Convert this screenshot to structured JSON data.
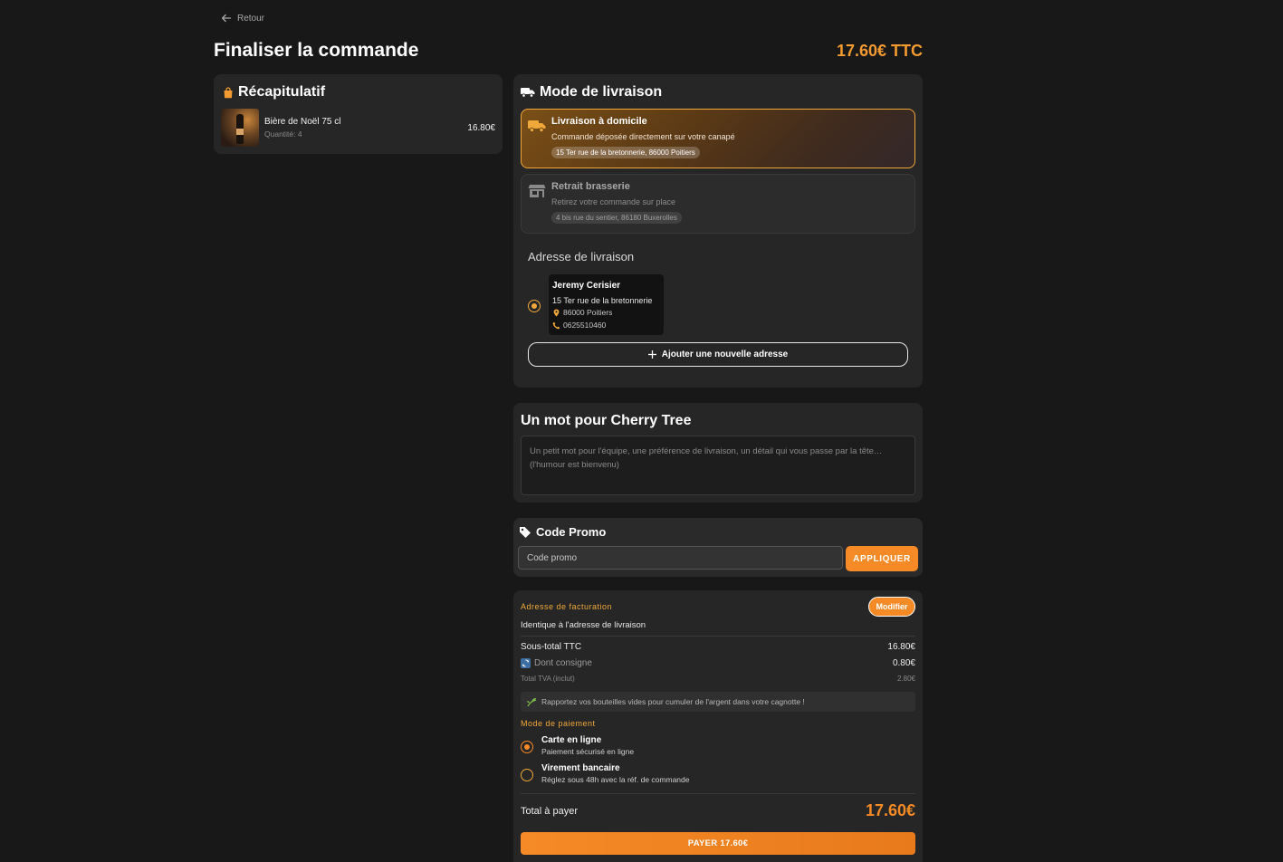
{
  "nav": {
    "back_label": "Retour"
  },
  "header": {
    "title": "Finaliser la commande",
    "total": "17.60€ TTC"
  },
  "summary": {
    "title": "Récapitulatif",
    "items": [
      {
        "name": "Bière de Noël 75 cl",
        "quantity": "Quantité: 4",
        "price": "16.80€"
      }
    ]
  },
  "delivery": {
    "title": "Mode de livraison",
    "options": [
      {
        "title": "Livraison à domicile",
        "description": "Commande déposée directement sur votre canapé",
        "address": "15 Ter rue de la bretonnerie, 86000 Poitiers",
        "selected": true
      },
      {
        "title": "Retrait brasserie",
        "description": "Retirez votre commande sur place",
        "address": "4 bis rue du sentier, 86180 Buxerolles",
        "selected": false
      }
    ],
    "address_section_title": "Adresse de livraison",
    "saved_address": {
      "name": "Jeremy Cerisier",
      "street": "15 Ter rue de la bretonnerie",
      "city": "86000 Poitiers",
      "phone": "0625510460"
    },
    "add_address_label": "Ajouter une nouvelle adresse"
  },
  "note": {
    "title": "Un mot pour Cherry Tree",
    "placeholder": "Un petit mot pour l'équipe, une préférence de livraison, un détail qui vous passe par la tête… (l'humour est bienvenu)"
  },
  "promo": {
    "title": "Code Promo",
    "placeholder": "Code promo",
    "apply_label": "APPLIQUER"
  },
  "checkout": {
    "billing_label": "Adresse de facturation",
    "modify_label": "Modifier",
    "billing_value": "Identique à l'adresse de livraison",
    "subtotal_label": "Sous-total TTC",
    "subtotal_value": "16.80€",
    "deposit_label": "Dont consigne",
    "deposit_value": "0.80€",
    "vat_label": "Total TVA (inclut)",
    "vat_value": "2.80€",
    "tip": "Rapportez vos bouteilles vides pour cumuler de l'argent dans votre cagnotte !",
    "payment_label": "Mode de paiement",
    "payment_options": [
      {
        "title": "Carte en ligne",
        "description": "Paiement sécurisé en ligne",
        "selected": true
      },
      {
        "title": "Virement bancaire",
        "description": "Réglez sous 48h avec la réf. de commande",
        "selected": false
      }
    ],
    "total_label": "Total à payer",
    "total_value": "17.60€",
    "pay_label": "PAYER 17.60€"
  },
  "colors": {
    "accent": "#f58a26",
    "accent_soft": "#f0a83a",
    "background": "#181818",
    "card": "#262626"
  }
}
